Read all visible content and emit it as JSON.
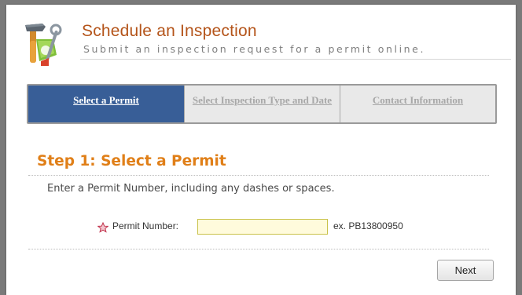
{
  "header": {
    "title": "Schedule an Inspection",
    "subtitle": "Submit an inspection request for a permit online.",
    "logo_icon": "tools-hammer-wrench-icon"
  },
  "steps": [
    {
      "label": "Select a Permit",
      "state": "active"
    },
    {
      "label": "Select Inspection Type and Date",
      "state": "inactive"
    },
    {
      "label": "Contact Information",
      "state": "inactive"
    }
  ],
  "main": {
    "step_heading": "Step 1: Select a Permit",
    "instruction": "Enter a Permit Number, including any dashes or spaces.",
    "permit_field": {
      "label": "Permit Number:",
      "value": "",
      "example": "ex. PB13800950",
      "required_icon": "required-star-icon"
    },
    "next_label": "Next"
  },
  "colors": {
    "title": "#b4541a",
    "active_step_bg": "#385e97",
    "step_heading": "#e07f18",
    "input_bg": "#fffbdc"
  }
}
